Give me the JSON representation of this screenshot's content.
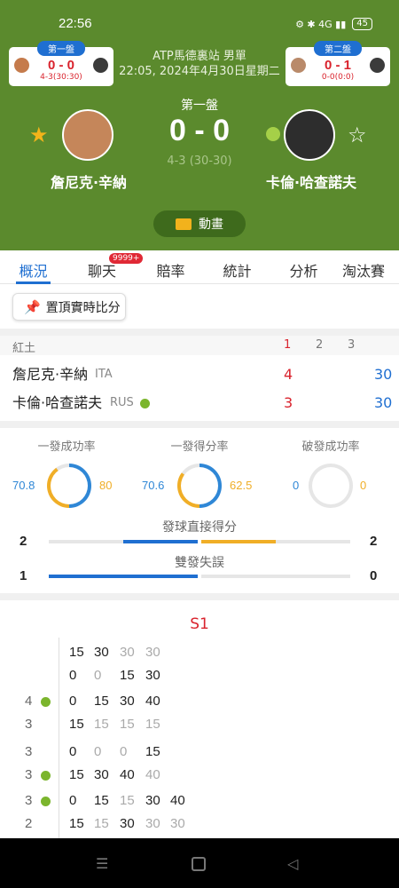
{
  "status": {
    "time": "22:56",
    "icons": "⚙ ✱ 4G ▮▮",
    "battery": "45"
  },
  "header": {
    "match_title_line1": "ATP馬德裏站 男單",
    "match_title_line2": "22:05, 2024年4月30日星期二",
    "set_label": "第一盤",
    "main_score": "0 - 0",
    "game_sub": "4-3 (30-30)",
    "left_card": {
      "tag": "第一盤",
      "score": "0 - 0",
      "sub": "4-3(30:30)"
    },
    "right_card": {
      "tag": "第二盤",
      "score": "0 - 1",
      "sub": "0-0(0:0)"
    },
    "player1": {
      "name": "詹尼克·辛納"
    },
    "player2": {
      "name": "卡倫·哈查諾夫"
    },
    "animation_label": "動畫"
  },
  "tabs": [
    {
      "label": "概況"
    },
    {
      "label": "聊天"
    },
    {
      "label": "賠率"
    },
    {
      "label": "統計"
    },
    {
      "label": "分析"
    },
    {
      "label": "淘汰賽"
    }
  ],
  "chat_badge": "9999+",
  "pin_label": "置頂實時比分",
  "scoreboard": {
    "court": "紅土",
    "set_headers": [
      "1",
      "2",
      "3"
    ],
    "rows": [
      {
        "name": "詹尼克·辛納",
        "country": "ITA",
        "set1": "4",
        "points": "30"
      },
      {
        "name": "卡倫·哈查諾夫",
        "country": "RUS",
        "set1": "3",
        "points": "30"
      }
    ]
  },
  "stats": {
    "first_serve_pct": {
      "label": "一發成功率",
      "p1": "70.8",
      "p2": "80"
    },
    "first_serve_won": {
      "label": "一發得分率",
      "p1": "70.6",
      "p2": "62.5"
    },
    "break_pts": {
      "label": "破發成功率",
      "p1": "0",
      "p2": "0"
    },
    "aces": {
      "label": "發球直接得分",
      "p1": "2",
      "p2": "2"
    },
    "double_faults": {
      "label": "雙發失誤",
      "p1": "1",
      "p2": "0"
    }
  },
  "pbp": {
    "set_label": "S1",
    "games": [
      {
        "g": "",
        "serve": false,
        "pts": [
          "15",
          "30",
          "30",
          "30"
        ]
      },
      {
        "g": "",
        "serve": false,
        "pts": [
          "0",
          "0",
          "15",
          "30"
        ]
      },
      {
        "g": "4",
        "serve": true,
        "pts": [
          "0",
          "15",
          "30",
          "40"
        ]
      },
      {
        "g": "3",
        "serve": false,
        "pts": [
          "15",
          "15",
          "15",
          "15"
        ]
      },
      {
        "g": "3",
        "serve": false,
        "pts": [
          "0",
          "0",
          "0",
          "15"
        ]
      },
      {
        "g": "3",
        "serve": true,
        "pts": [
          "15",
          "30",
          "40",
          "40"
        ]
      },
      {
        "g": "3",
        "serve": true,
        "pts": [
          "0",
          "15",
          "15",
          "30",
          "40"
        ]
      },
      {
        "g": "2",
        "serve": false,
        "pts": [
          "15",
          "15",
          "30",
          "30",
          "30"
        ]
      }
    ]
  },
  "colors": {
    "header_bg": "#5b8a2d",
    "accent_blue": "#1f6fd1",
    "accent_red": "#d9232d",
    "ring_blue": "#2f87d6",
    "ring_orange": "#f0ae27",
    "serve_green": "#7bb52d"
  }
}
